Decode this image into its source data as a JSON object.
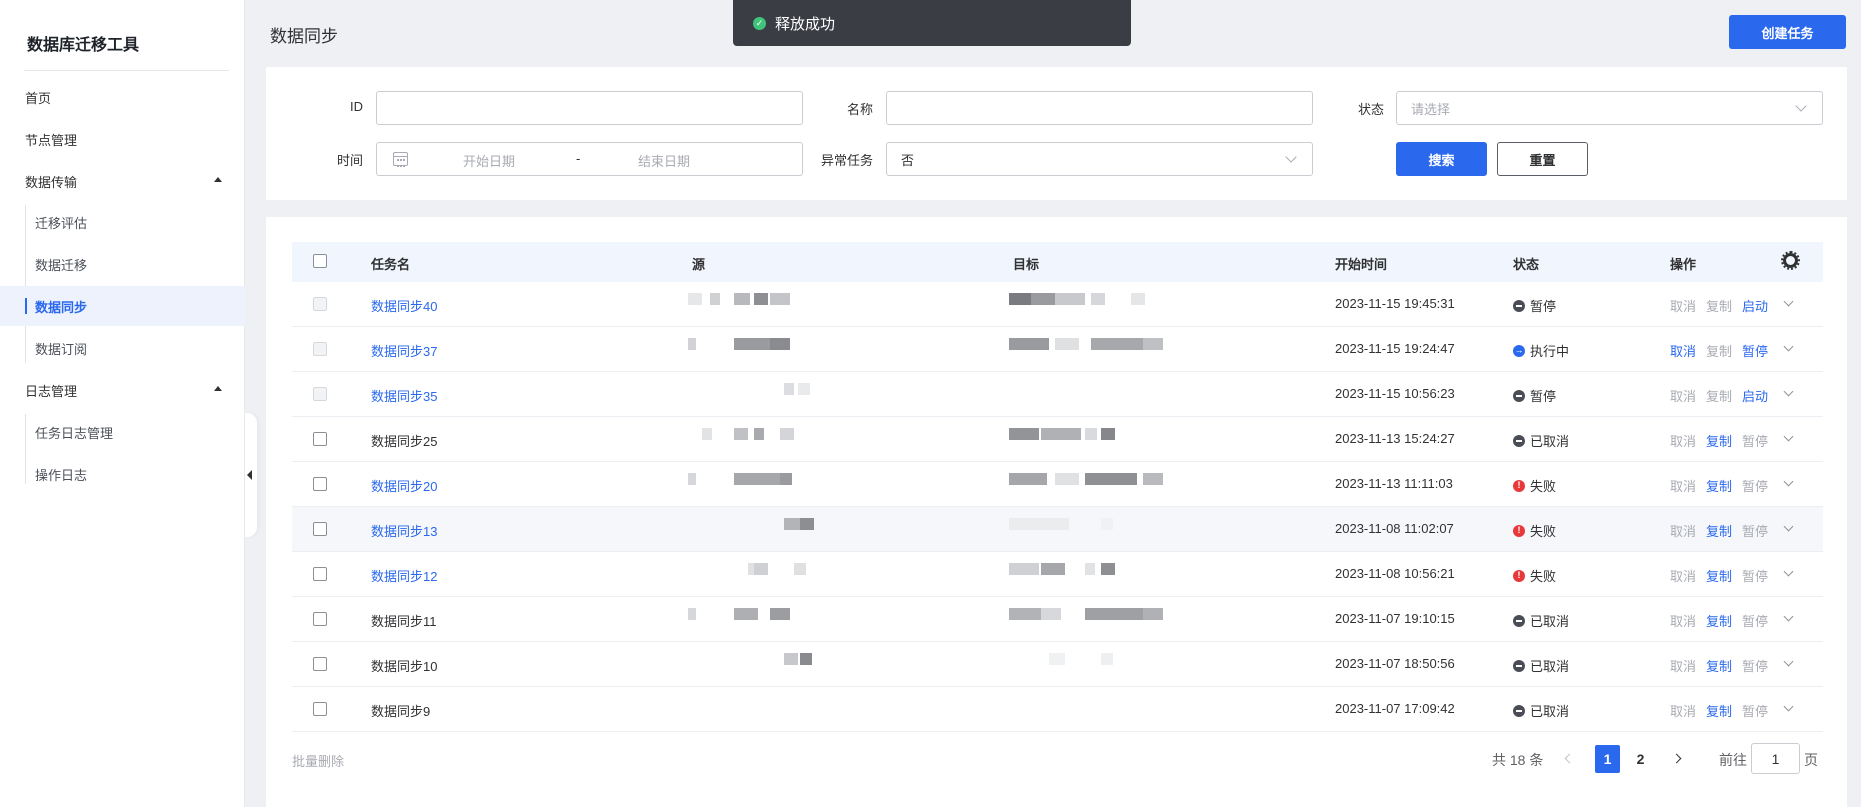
{
  "sidebar": {
    "brand": "数据库迁移工具",
    "items": [
      {
        "label": "首页"
      },
      {
        "label": "节点管理"
      },
      {
        "label": "数据传输"
      },
      {
        "label": "迁移评估"
      },
      {
        "label": "数据迁移"
      },
      {
        "label": "数据同步"
      },
      {
        "label": "数据订阅"
      },
      {
        "label": "日志管理"
      },
      {
        "label": "任务日志管理"
      },
      {
        "label": "操作日志"
      }
    ]
  },
  "header": {
    "title": "数据同步",
    "create_label": "创建任务"
  },
  "toast": {
    "message": "释放成功"
  },
  "filters": {
    "id_label": "ID",
    "id_value": "",
    "name_label": "名称",
    "name_value": "",
    "status_label": "状态",
    "status_placeholder": "请选择",
    "time_label": "时间",
    "start_placeholder": "开始日期",
    "range_sep": "-",
    "end_placeholder": "结束日期",
    "abnormal_label": "异常任务",
    "abnormal_value": "否",
    "search_label": "搜索",
    "reset_label": "重置"
  },
  "table": {
    "columns": {
      "name": "任务名",
      "source": "源",
      "target": "目标",
      "start_time": "开始时间",
      "status": "状态",
      "ops": "操作"
    },
    "rows": [
      {
        "name": "数据同步40",
        "start_time": "2023-11-15 19:45:31",
        "status": "暂停",
        "ops": [
          "取消",
          "复制",
          "启动"
        ]
      },
      {
        "name": "数据同步37",
        "start_time": "2023-11-15 19:24:47",
        "status": "执行中",
        "ops": [
          "取消",
          "复制",
          "暂停"
        ]
      },
      {
        "name": "数据同步35",
        "start_time": "2023-11-15 10:56:23",
        "status": "暂停",
        "ops": [
          "取消",
          "复制",
          "启动"
        ]
      },
      {
        "name": "数据同步25",
        "start_time": "2023-11-13 15:24:27",
        "status": "已取消",
        "ops": [
          "取消",
          "复制",
          "暂停"
        ]
      },
      {
        "name": "数据同步20",
        "start_time": "2023-11-13 11:11:03",
        "status": "失败",
        "ops": [
          "取消",
          "复制",
          "暂停"
        ]
      },
      {
        "name": "数据同步13",
        "start_time": "2023-11-08 11:02:07",
        "status": "失败",
        "ops": [
          "取消",
          "复制",
          "暂停"
        ]
      },
      {
        "name": "数据同步12",
        "start_time": "2023-11-08 10:56:21",
        "status": "失败",
        "ops": [
          "取消",
          "复制",
          "暂停"
        ]
      },
      {
        "name": "数据同步11",
        "start_time": "2023-11-07 19:10:15",
        "status": "已取消",
        "ops": [
          "取消",
          "复制",
          "暂停"
        ]
      },
      {
        "name": "数据同步10",
        "start_time": "2023-11-07 18:50:56",
        "status": "已取消",
        "ops": [
          "取消",
          "复制",
          "暂停"
        ]
      },
      {
        "name": "数据同步9",
        "start_time": "2023-11-07 17:09:42",
        "status": "已取消",
        "ops": [
          "取消",
          "复制",
          "暂停"
        ]
      }
    ]
  },
  "footer": {
    "bulk_delete": "批量删除",
    "total": "共 18 条",
    "pages": [
      "1",
      "2"
    ],
    "current_page": "1",
    "goto_prefix": "前往",
    "goto_value": "1",
    "goto_suffix": "页"
  },
  "colors": {
    "accent": "#2a68ee",
    "fail": "#e8393a",
    "toast_bg": "#3a3d44"
  }
}
